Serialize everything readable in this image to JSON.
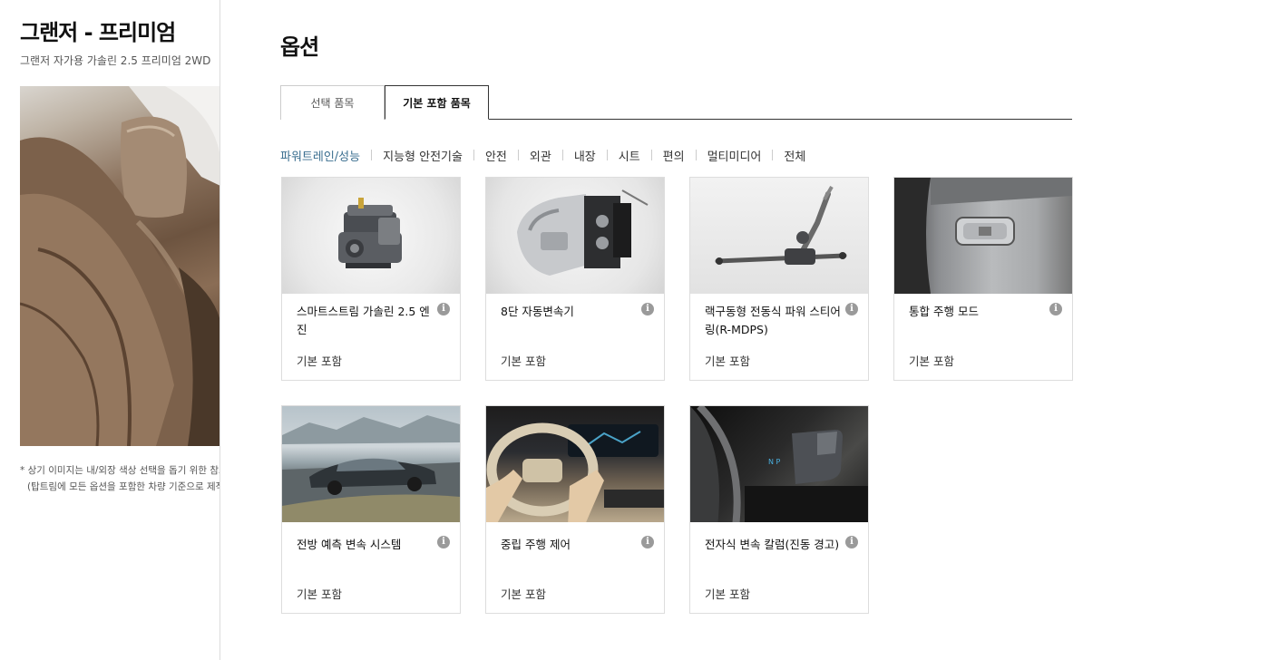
{
  "car": {
    "title": "그랜저 - 프리미엄",
    "subtitle": "그랜저 자가용 가솔린 2.5 프리미엄 2WD",
    "note_line1": "* 상기 이미지는 내/외장 색상 선택을 돕기 위한 참고",
    "note_line2": "(탑트림에 모든 옵션을 포함한 차량 기준으로 제작"
  },
  "page": {
    "title": "옵션"
  },
  "tabs": [
    {
      "label": "선택 품목",
      "selected": false
    },
    {
      "label": "기본 포함 품목",
      "selected": true
    }
  ],
  "categories": [
    {
      "label": "파워트레인/성능",
      "active": true
    },
    {
      "label": "지능형 안전기술",
      "active": false
    },
    {
      "label": "안전",
      "active": false
    },
    {
      "label": "외관",
      "active": false
    },
    {
      "label": "내장",
      "active": false
    },
    {
      "label": "시트",
      "active": false
    },
    {
      "label": "편의",
      "active": false
    },
    {
      "label": "멀티미디어",
      "active": false
    },
    {
      "label": "전체",
      "active": false
    }
  ],
  "cards": [
    {
      "name": "스마트스트림 가솔린 2.5 엔진",
      "status": "기본 포함",
      "icon": "engine-image"
    },
    {
      "name": "8단 자동변속기",
      "status": "기본 포함",
      "icon": "transmission-image"
    },
    {
      "name": "랙구동형 전동식 파워 스티어링(R-MDPS)",
      "status": "기본 포함",
      "icon": "steering-rack-image"
    },
    {
      "name": "통합 주행 모드",
      "status": "기본 포함",
      "icon": "drive-mode-button-image"
    },
    {
      "name": "전방 예측 변속 시스템",
      "status": "기본 포함",
      "icon": "car-on-road-image"
    },
    {
      "name": "중립 주행 제어",
      "status": "기본 포함",
      "icon": "steering-wheel-image"
    },
    {
      "name": "전자식 변속 칼럼(진동 경고)",
      "status": "기본 포함",
      "icon": "column-shifter-image"
    }
  ],
  "info_glyph": "i"
}
